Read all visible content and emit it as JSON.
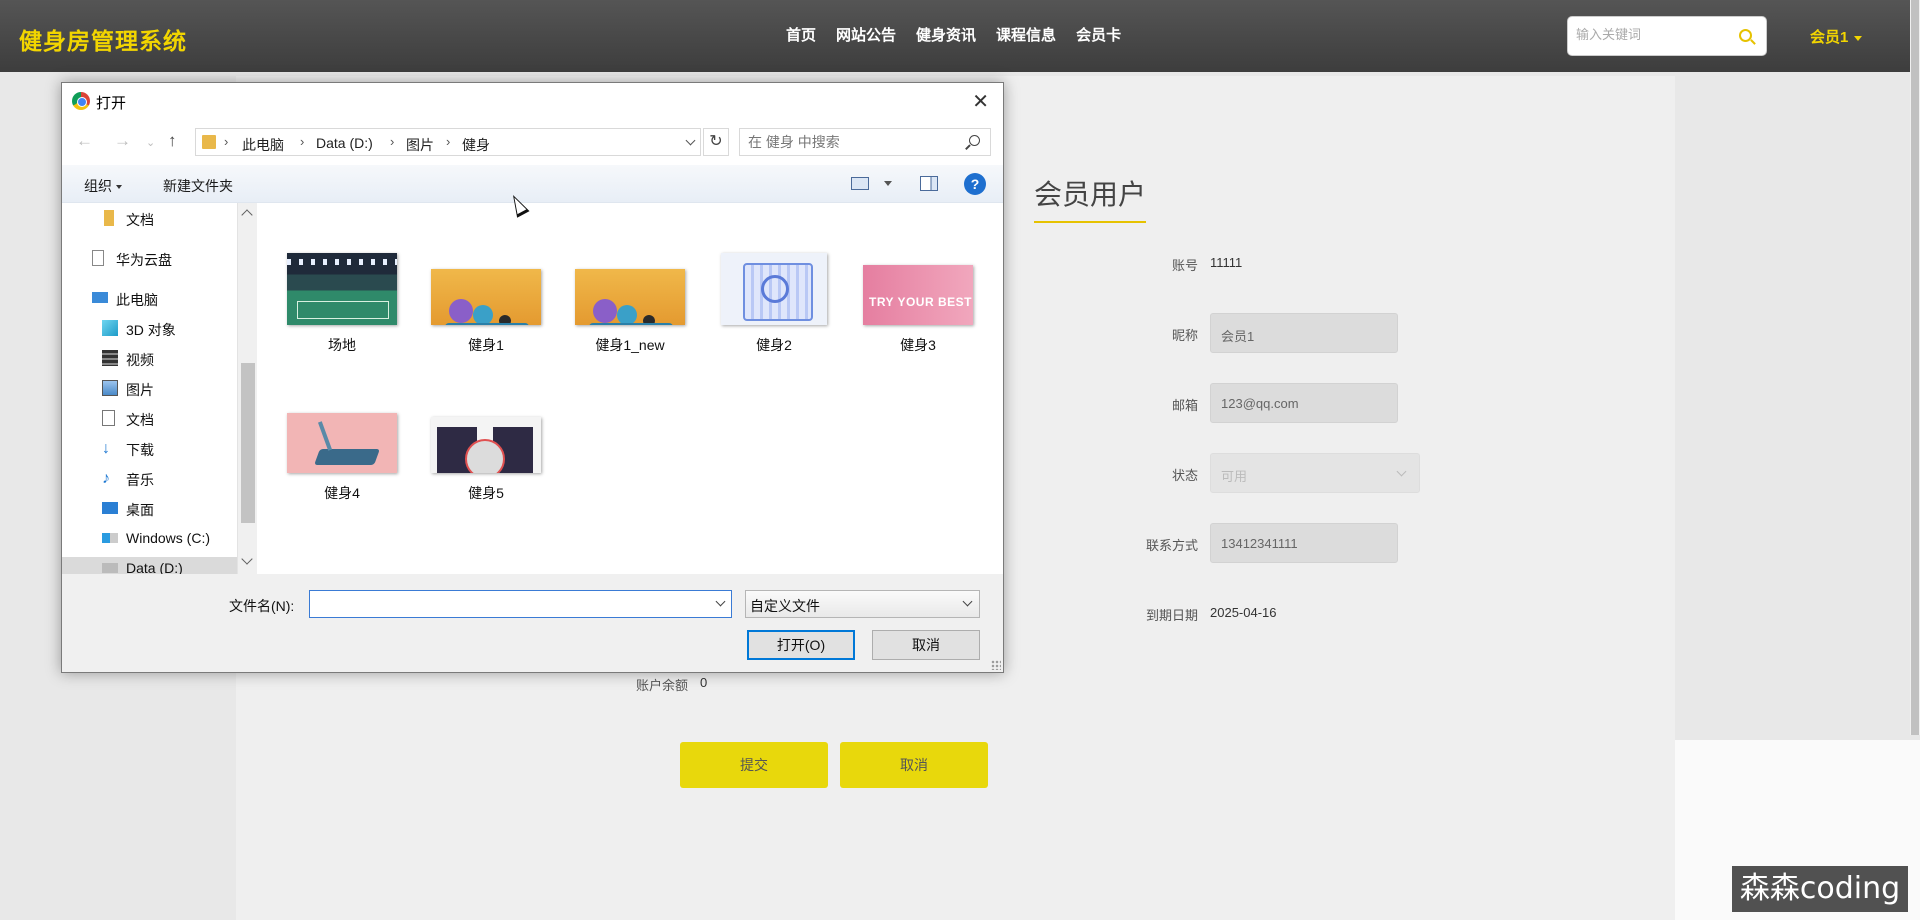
{
  "site": {
    "brand": "健身房管理系统",
    "nav": [
      "首页",
      "网站公告",
      "健身资讯",
      "课程信息",
      "会员卡"
    ],
    "search_placeholder": "输入关键词",
    "user_menu": "会员1",
    "accent_color": "#f2d500"
  },
  "profile": {
    "title": "会员用户",
    "fields": [
      {
        "label": "账号",
        "value": "11111",
        "kind": "text"
      },
      {
        "label": "昵称",
        "value": "会员1",
        "kind": "input"
      },
      {
        "label": "邮箱",
        "value": "123@qq.com",
        "kind": "input"
      },
      {
        "label": "状态",
        "value": "可用",
        "kind": "select"
      },
      {
        "label": "联系方式",
        "value": "13412341111",
        "kind": "input"
      },
      {
        "label": "到期日期",
        "value": "2025-04-16",
        "kind": "text"
      }
    ],
    "balance_label": "账户余额",
    "balance_value": "0",
    "submit_label": "提交",
    "cancel_label": "取消"
  },
  "dialog": {
    "title": "打开",
    "breadcrumb": [
      "此电脑",
      "Data (D:)",
      "图片",
      "健身"
    ],
    "search_placeholder": "在 健身 中搜索",
    "toolbar": {
      "organize": "组织",
      "new_folder": "新建文件夹",
      "help": "?"
    },
    "nav_items": [
      {
        "label": "文档",
        "icon": "folder-icon"
      },
      {
        "label": "华为云盘",
        "icon": "cloud-drive-icon"
      },
      {
        "label": "此电脑",
        "icon": "computer-icon"
      },
      {
        "label": "3D 对象",
        "icon": "cube-icon"
      },
      {
        "label": "视频",
        "icon": "video-icon"
      },
      {
        "label": "图片",
        "icon": "pictures-icon"
      },
      {
        "label": "文档",
        "icon": "documents-icon"
      },
      {
        "label": "下载",
        "icon": "download-icon"
      },
      {
        "label": "音乐",
        "icon": "music-icon"
      },
      {
        "label": "桌面",
        "icon": "desktop-icon"
      },
      {
        "label": "Windows (C:)",
        "icon": "drive-c-icon"
      },
      {
        "label": "Data (D:)",
        "icon": "drive-d-icon"
      }
    ],
    "files": [
      {
        "name": "场地"
      },
      {
        "name": "健身1"
      },
      {
        "name": "健身1_new"
      },
      {
        "name": "健身2"
      },
      {
        "name": "健身3",
        "caption": "TRY YOUR BEST"
      },
      {
        "name": "健身4"
      },
      {
        "name": "健身5"
      }
    ],
    "filename_label": "文件名(N):",
    "filename_value": "",
    "filetype": "自定义文件",
    "open_label": "打开(O)",
    "cancel_label": "取消"
  },
  "watermark": "森森coding"
}
